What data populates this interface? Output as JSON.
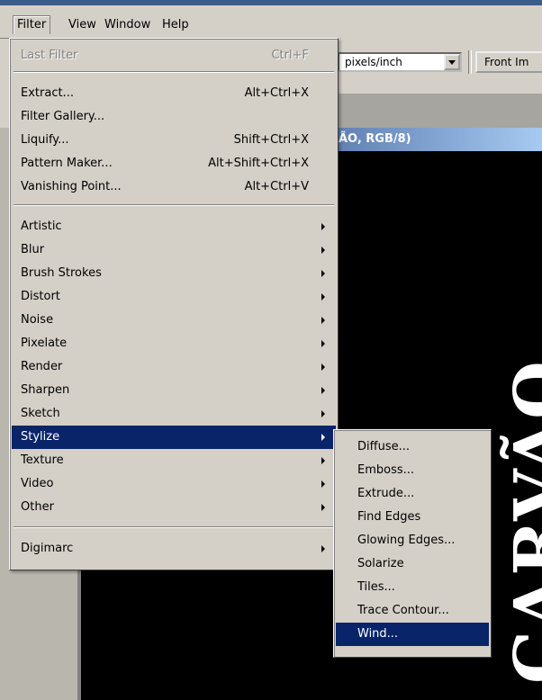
{
  "menubar": [
    "Filter",
    "View",
    "Window",
    "Help"
  ],
  "options": {
    "resolution_unit": "pixels/inch",
    "front_button": "Front Im"
  },
  "document": {
    "title": "ÃO, RGB/8)",
    "canvas_text": "CARVÃO"
  },
  "filter_menu": {
    "last_filter": {
      "label": "Last Filter",
      "shortcut": "Ctrl+F"
    },
    "group1": [
      {
        "label": "Extract...",
        "shortcut": "Alt+Ctrl+X"
      },
      {
        "label": "Filter Gallery...",
        "shortcut": ""
      },
      {
        "label": "Liquify...",
        "shortcut": "Shift+Ctrl+X"
      },
      {
        "label": "Pattern Maker...",
        "shortcut": "Alt+Shift+Ctrl+X"
      },
      {
        "label": "Vanishing Point...",
        "shortcut": "Alt+Ctrl+V"
      }
    ],
    "submenus": [
      "Artistic",
      "Blur",
      "Brush Strokes",
      "Distort",
      "Noise",
      "Pixelate",
      "Render",
      "Sharpen",
      "Sketch",
      "Stylize",
      "Texture",
      "Video",
      "Other"
    ],
    "digimarc": "Digimarc"
  },
  "stylize_menu": [
    "Diffuse...",
    "Emboss...",
    "Extrude...",
    "Find Edges",
    "Glowing Edges...",
    "Solarize",
    "Tiles...",
    "Trace Contour...",
    "Wind..."
  ],
  "colors": {
    "highlight": "#0a246a",
    "menu_bg": "#d4d0c8"
  }
}
